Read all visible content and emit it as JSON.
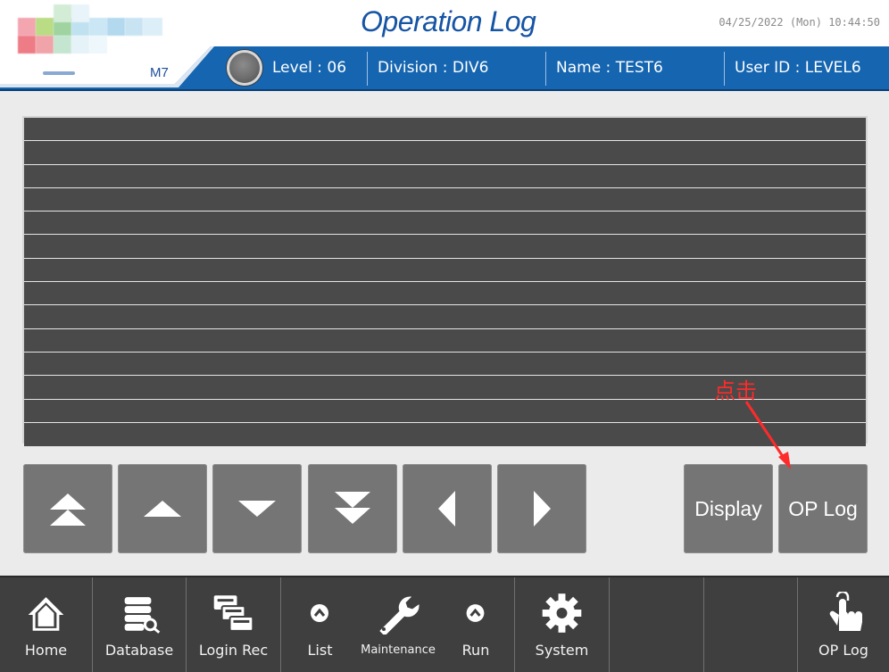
{
  "header": {
    "title": "Operation Log",
    "datetime": "04/25/2022 (Mon) 10:44:50",
    "model": "M7"
  },
  "user_bar": {
    "level": "Level : 06",
    "division": "Division : DIV6",
    "name": "Name : TEST6",
    "user_id": "User ID : LEVEL6"
  },
  "log_table": {
    "rows": [
      "",
      "",
      "",
      "",
      "",
      "",
      "",
      "",
      "",
      "",
      "",
      "",
      "",
      ""
    ]
  },
  "paging_buttons": [
    {
      "icon": "double-up-icon"
    },
    {
      "icon": "up-icon"
    },
    {
      "icon": "down-icon"
    },
    {
      "icon": "double-down-icon"
    },
    {
      "icon": "left-icon"
    },
    {
      "icon": "right-icon"
    }
  ],
  "actions": {
    "display_label": "Display",
    "op_log_label": "OP Log"
  },
  "annotation": {
    "text": "点击",
    "color": "#ff2a2a"
  },
  "nav": {
    "home": "Home",
    "database": "Database",
    "login_rec": "Login Rec",
    "list": "List",
    "maintenance": "Maintenance",
    "run": "Run",
    "system": "System",
    "op_log": "OP Log"
  },
  "colors": {
    "title_blue": "#1654a4",
    "bar_blue": "#1565b0",
    "button_gray": "#757575",
    "nav_bg": "#3f3f3f"
  }
}
